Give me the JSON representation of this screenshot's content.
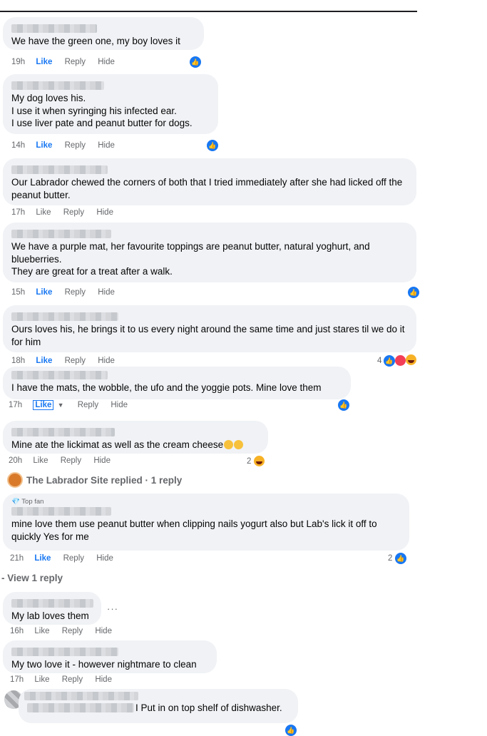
{
  "comments": [
    {
      "text": "We have the green one, my boy loves it",
      "time": "19h",
      "like": "Like",
      "reply": "Reply",
      "hide": "Hide"
    },
    {
      "text": "My dog loves his.\nI use it when syringing his infected ear.\nI use liver pate and peanut butter for dogs.",
      "time": "14h",
      "like": "Like",
      "reply": "Reply",
      "hide": "Hide"
    },
    {
      "text": "Our Labrador chewed the corners of both that I tried immediately after she had licked off the peanut butter.",
      "time": "17h",
      "like": "Like",
      "reply": "Reply",
      "hide": "Hide"
    },
    {
      "text": "We have a purple mat, her favourite toppings are peanut butter, natural yoghurt, and blueberries.\nThey are great for a treat after a walk.",
      "time": "15h",
      "like": "Like",
      "reply": "Reply",
      "hide": "Hide"
    },
    {
      "text": "Ours loves his, he brings it to us every night around the same time and just stares til we do it for him",
      "time": "18h",
      "like": "Like",
      "reply": "Reply",
      "hide": "Hide",
      "reactions": "4"
    },
    {
      "text": "I have the mats, the wobble, the ufo and the yoggie pots. Mine love them",
      "time": "17h",
      "like": "Like",
      "reply": "Reply",
      "hide": "Hide"
    },
    {
      "text": "Mine ate the lickimat as well as the cream cheese",
      "time": "20h",
      "like": "Like",
      "reply": "Reply",
      "hide": "Hide",
      "reactions": "2"
    },
    {
      "text": "mine love them use peanut butter when clipping nails yogurt also but Lab's lick it off to quickly Yes for me",
      "time": "21h",
      "like": "Like",
      "reply": "Reply",
      "hide": "Hide",
      "reactions": "2",
      "badge": "Top fan"
    },
    {
      "text": "My lab loves them",
      "time": "16h",
      "like": "Like",
      "reply": "Reply",
      "hide": "Hide"
    },
    {
      "text": "My two love it - however nightmare to clean",
      "time": "17h",
      "like": "Like",
      "reply": "Reply",
      "hide": "Hide"
    },
    {
      "text": "I Put in on top shelf of dishwasher."
    }
  ],
  "page_reply": "The Labrador Site replied · 1 reply",
  "view_reply": "View 1 reply",
  "colors": {
    "like_blue": "#1877f2",
    "bubble": "#f0f2f5",
    "meta": "#65676b"
  }
}
